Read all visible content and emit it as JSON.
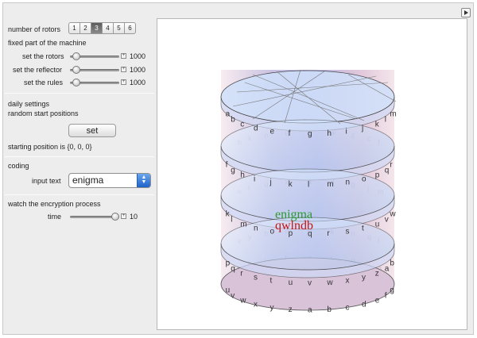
{
  "controls": {
    "number_of_rotors_label": "number of rotors",
    "rotor_options": [
      "1",
      "2",
      "3",
      "4",
      "5",
      "6"
    ],
    "rotor_selected": "3",
    "fixed_part_label": "fixed part of the machine",
    "set_rotors_label": "set the rotors",
    "set_rotors_value": "1000",
    "set_reflector_label": "set the reflector",
    "set_reflector_value": "1000",
    "set_rules_label": "set the rules",
    "set_rules_value": "1000",
    "daily_settings_label": "daily settings",
    "random_start_label": "random start positions",
    "set_button_label": "set",
    "starting_position_text": "starting position is {0, 0, 0}",
    "coding_label": "coding",
    "input_text_label": "input text",
    "input_text_value": "enigma",
    "watch_label": "watch the encryption process",
    "time_label": "time",
    "time_value": "10",
    "plus_symbol": "+"
  },
  "sliders": {
    "set_rotors_fraction": 0.05,
    "set_reflector_fraction": 0.05,
    "set_rules_fraction": 0.05,
    "time_fraction": 1.0
  },
  "graphic": {
    "plaintext": "enigma",
    "ciphertext": "qwlndb",
    "plaintext_color": "#2e9a2e",
    "ciphertext_color": "#cc1111",
    "glyph_letters": [
      "a",
      "b",
      "c",
      "d",
      "e",
      "f",
      "g",
      "h",
      "i",
      "j",
      "k",
      "l",
      "m",
      "n",
      "o",
      "p",
      "q",
      "r",
      "s",
      "t",
      "u",
      "v",
      "w",
      "x",
      "y",
      "z"
    ]
  },
  "icons": {
    "top_button": "play-arrow-icon",
    "popup": "updown-arrow-icon"
  }
}
